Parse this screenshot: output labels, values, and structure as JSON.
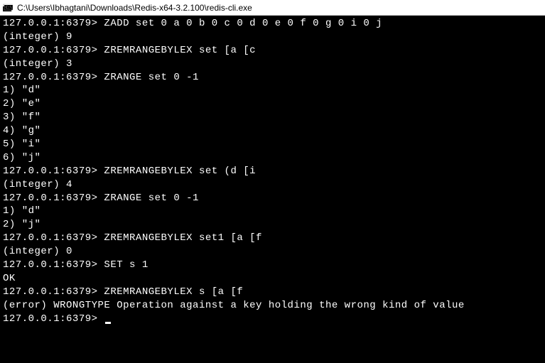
{
  "title_bar": {
    "path": "C:\\Users\\Ibhagtani\\Downloads\\Redis-x64-3.2.100\\redis-cli.exe"
  },
  "terminal": {
    "prompt": "127.0.0.1:6379>",
    "lines": [
      {
        "prompt": true,
        "cmd": "ZADD set 0 a 0 b 0 c 0 d 0 e 0 f 0 g 0 i 0 j"
      },
      {
        "text": "(integer) 9"
      },
      {
        "prompt": true,
        "cmd": "ZREMRANGEBYLEX set [a [c"
      },
      {
        "text": "(integer) 3"
      },
      {
        "prompt": true,
        "cmd": "ZRANGE set 0 -1"
      },
      {
        "text": "1) \"d\""
      },
      {
        "text": "2) \"e\""
      },
      {
        "text": "3) \"f\""
      },
      {
        "text": "4) \"g\""
      },
      {
        "text": "5) \"i\""
      },
      {
        "text": "6) \"j\""
      },
      {
        "prompt": true,
        "cmd": "ZREMRANGEBYLEX set (d [i"
      },
      {
        "text": "(integer) 4"
      },
      {
        "prompt": true,
        "cmd": "ZRANGE set 0 -1"
      },
      {
        "text": "1) \"d\""
      },
      {
        "text": "2) \"j\""
      },
      {
        "prompt": true,
        "cmd": "ZREMRANGEBYLEX set1 [a [f"
      },
      {
        "text": "(integer) 0"
      },
      {
        "prompt": true,
        "cmd": "SET s 1"
      },
      {
        "text": "OK"
      },
      {
        "prompt": true,
        "cmd": "ZREMRANGEBYLEX s [a [f"
      },
      {
        "text": "(error) WRONGTYPE Operation against a key holding the wrong kind of value"
      },
      {
        "prompt": true,
        "cmd": "",
        "cursor": true
      }
    ]
  }
}
